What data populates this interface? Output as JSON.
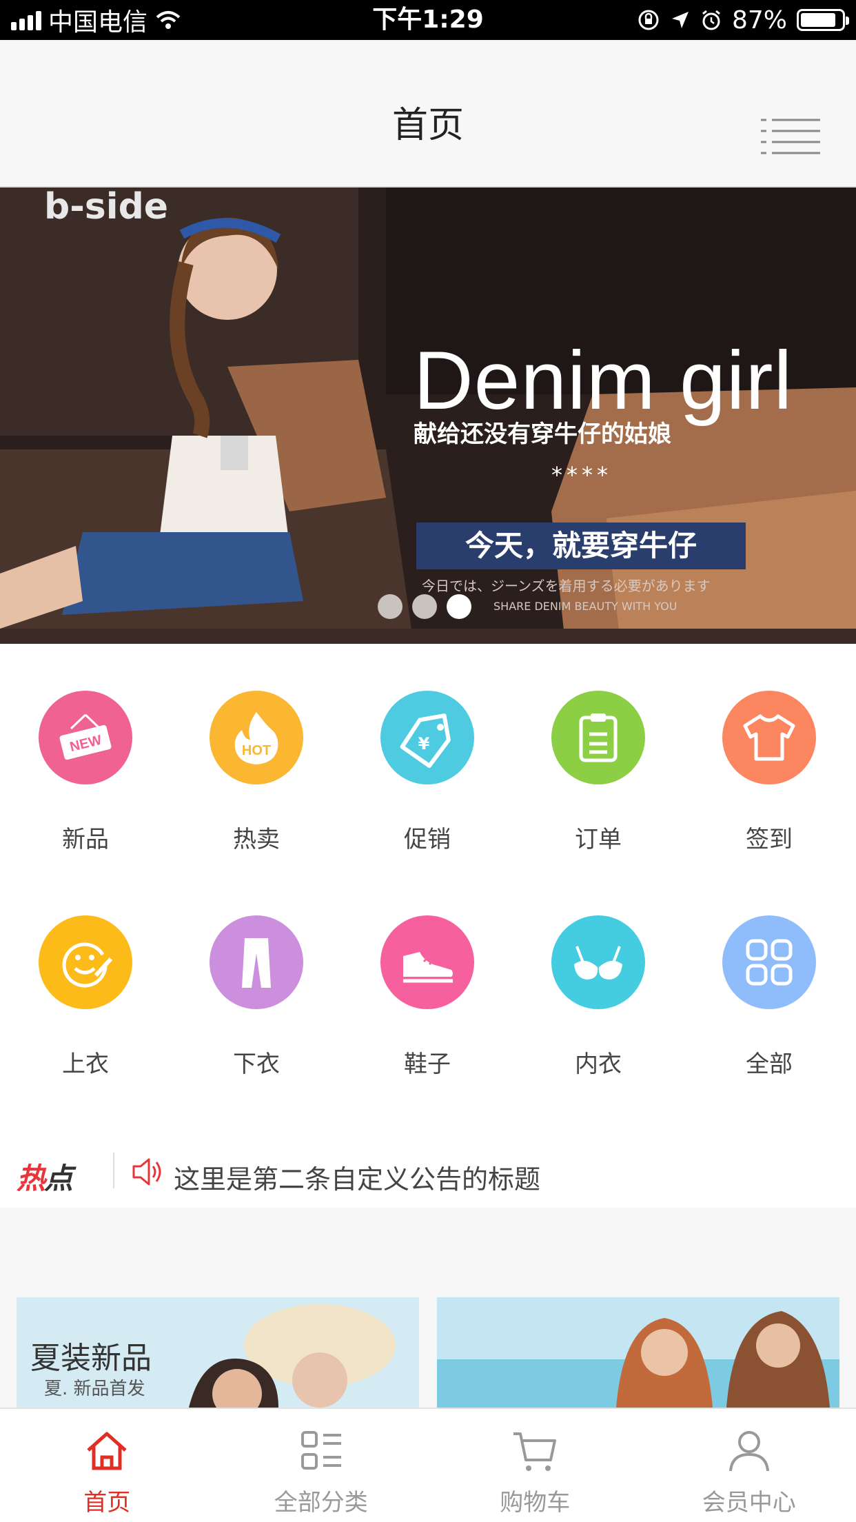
{
  "status_bar": {
    "carrier": "中国电信",
    "time": "下午1:29",
    "battery": "87%",
    "battery_level": 0.87
  },
  "nav": {
    "title": "首页",
    "menu_icon": "list-menu-icon"
  },
  "banner": {
    "brand": "b-side",
    "headline": "Denim girl",
    "subtitle": "献给还没有穿牛仔的姑娘",
    "stars": "****",
    "cta": "今天，就要穿牛仔",
    "jp_text": "今日では、ジーンズを着用する必要があります",
    "en_text": "SHARE DENIM BEAUTY WITH YOU",
    "slide_count": 3,
    "active_slide": 3
  },
  "categories": [
    {
      "label": "新品",
      "icon": "new-tag-icon",
      "color": "#f06292"
    },
    {
      "label": "热卖",
      "icon": "hot-flame-icon",
      "color": "#fbb632"
    },
    {
      "label": "促销",
      "icon": "price-tag-icon",
      "color": "#4ecbe0"
    },
    {
      "label": "订单",
      "icon": "clipboard-icon",
      "color": "#8ccf45"
    },
    {
      "label": "签到",
      "icon": "tshirt-icon",
      "color": "#fb8660"
    },
    {
      "label": "上衣",
      "icon": "smile-pen-icon",
      "color": "#fdbb1a"
    },
    {
      "label": "下衣",
      "icon": "pants-icon",
      "color": "#cb8fde"
    },
    {
      "label": "鞋子",
      "icon": "sneaker-icon",
      "color": "#f7609f"
    },
    {
      "label": "内衣",
      "icon": "bra-icon",
      "color": "#44cde0"
    },
    {
      "label": "全部",
      "icon": "grid-icon",
      "color": "#8fbcfa"
    }
  ],
  "notice": {
    "badge": "热点",
    "text": "这里是第二条自定义公告的标题"
  },
  "promos": [
    {
      "title": "夏装新品",
      "subtitle": "夏. 新品首发"
    },
    {
      "title": "",
      "subtitle": ""
    }
  ],
  "tabbar": [
    {
      "label": "首页",
      "icon": "home-icon",
      "active": true
    },
    {
      "label": "全部分类",
      "icon": "category-list-icon",
      "active": false
    },
    {
      "label": "购物车",
      "icon": "cart-icon",
      "active": false
    },
    {
      "label": "会员中心",
      "icon": "user-icon",
      "active": false
    }
  ],
  "colors": {
    "accent": "#e02e24",
    "inactive": "#999999"
  }
}
